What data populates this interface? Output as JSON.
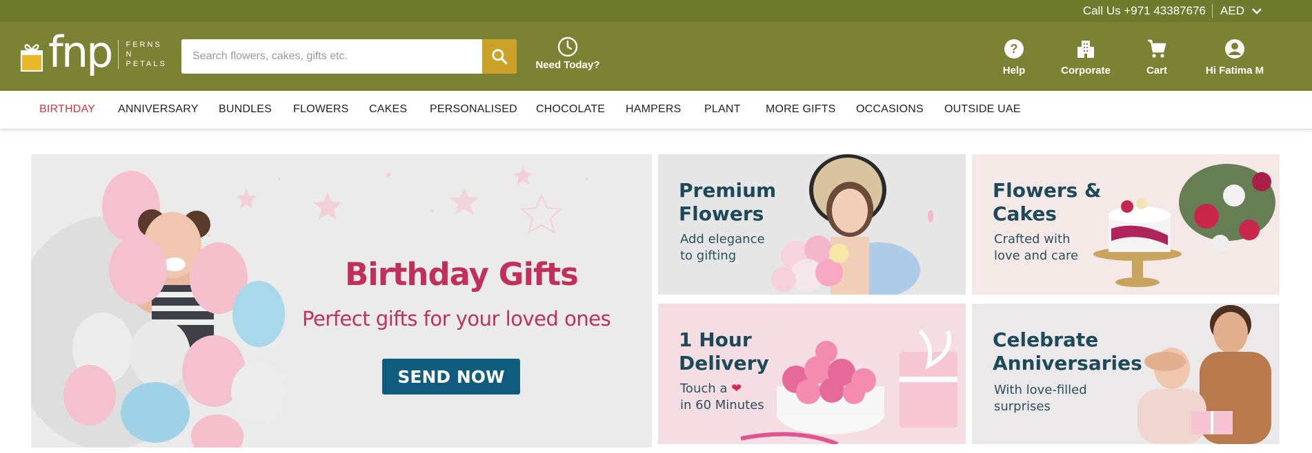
{
  "topbar": {
    "call": "Call Us +971 43387676",
    "currency": "AED"
  },
  "logo": {
    "word": "fnp",
    "tag1": "FERNS",
    "tag2": "N",
    "tag3": "PETALS"
  },
  "search": {
    "placeholder": "Search flowers, cakes, gifts etc."
  },
  "need_today": "Need Today?",
  "header_icons": {
    "help": "Help",
    "corporate": "Corporate",
    "cart": "Cart",
    "account": "Hi Fatima M"
  },
  "nav": [
    "BIRTHDAY",
    "ANNIVERSARY",
    "BUNDLES",
    "FLOWERS",
    "CAKES",
    "PERSONALISED",
    "CHOCOLATE",
    "HAMPERS",
    "PLANT",
    "MORE GIFTS",
    "OCCASIONS",
    "OUTSIDE UAE"
  ],
  "main_banner": {
    "title": "Birthday Gifts",
    "subtitle": "Perfect gifts for your loved ones",
    "cta": "SEND NOW"
  },
  "tiles": [
    {
      "title1": "Premium",
      "title2": "Flowers",
      "sub1": "Add elegance",
      "sub2": "to gifting"
    },
    {
      "title1": "Flowers &",
      "title2": "Cakes",
      "sub1": "Crafted with",
      "sub2": "love and care"
    },
    {
      "title1": "1 Hour",
      "title2": "Delivery",
      "sub1": "Touch a",
      "sub2": "in 60 Minutes"
    },
    {
      "title1": "Celebrate",
      "title2": "Anniversaries",
      "sub1": "With love-filled",
      "sub2": "surprises"
    }
  ],
  "colors": {
    "topbar": "#6e7a2c",
    "header": "#7c8234",
    "search_button": "#c9a227",
    "nav_active": "#d4373b",
    "banner_title": "#c0305a",
    "cta": "#0f5c7e",
    "tile_text": "#1d4a5b"
  }
}
